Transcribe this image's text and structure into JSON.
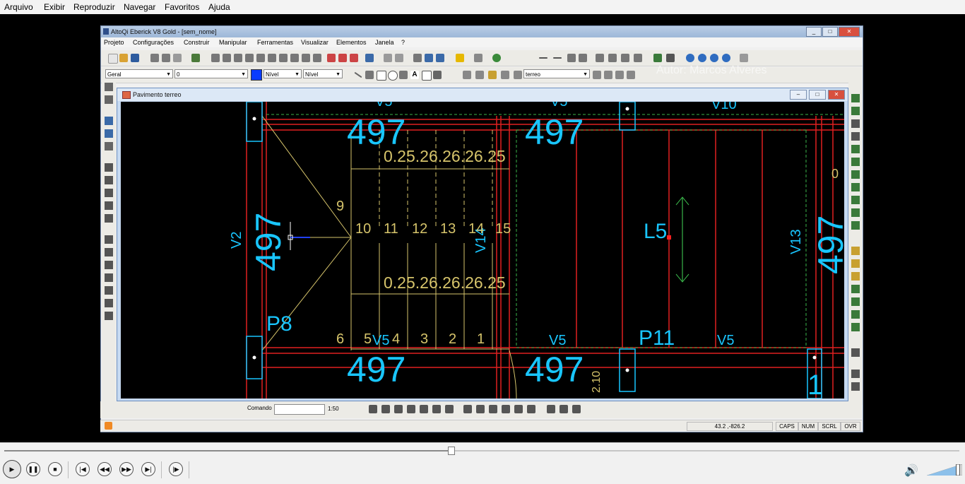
{
  "player_menu": [
    "Arquivo",
    "Exibir",
    "Reproduzir",
    "Navegar",
    "Favoritos",
    "Ajuda"
  ],
  "app": {
    "title": "AltoQi Eberick V8 Gold - [sem_nome]",
    "menu": [
      "Projeto",
      "Configurações",
      "Construir",
      "Manipular",
      "Ferramentas",
      "Visualizar",
      "Elementos",
      "Janela",
      "?"
    ],
    "combos": {
      "layer": "Geral",
      "value": "0",
      "level1": "Nível",
      "level2": "Nível",
      "floor": "terreo"
    },
    "watermark": "Autor: Marcos Alveres"
  },
  "doc": {
    "title": "Pavimento terreo",
    "drawing": {
      "big_numbers": [
        "497",
        "497",
        "497",
        "497"
      ],
      "vertical_numbers": [
        "497",
        "497"
      ],
      "beams": [
        "V2",
        "V14",
        "V13",
        "V5",
        "V5",
        "V5",
        "V10",
        "V5",
        "V5"
      ],
      "pillars": [
        "P8",
        "P11"
      ],
      "slab": "L5",
      "step_dims_top": "0.25.26.26.26.25",
      "step_dims_bottom": "0.25.26.26.26.25",
      "steps_top": [
        "9",
        "10",
        "11",
        "12",
        "13",
        "14",
        "15"
      ],
      "steps_bottom": [
        "6",
        "5",
        "4",
        "3",
        "2",
        "1"
      ],
      "side_texts": [
        "2.10",
        "1"
      ],
      "small_digit": "0"
    }
  },
  "command": {
    "label": "Comando",
    "scale": "1:50"
  },
  "status": {
    "coords": "43.2 ,-826.2",
    "caps": "CAPS",
    "num": "NUM",
    "scrl": "SCRL",
    "ovr": "OVR"
  },
  "player": {
    "progress": 0.468,
    "buttons": [
      "play",
      "pause",
      "stop",
      "previous",
      "rewind",
      "forward",
      "next",
      "frame"
    ],
    "volume": 0.85
  },
  "colors": {
    "cad_cyan": "#19c6ff",
    "cad_red": "#ff2020",
    "cad_yellow": "#d6c46b",
    "cad_green": "#39b54a",
    "cad_white": "#ffffff"
  }
}
